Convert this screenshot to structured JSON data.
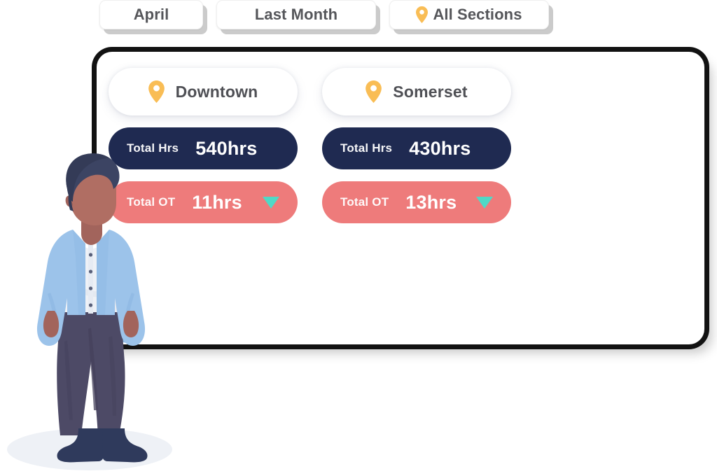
{
  "filters": [
    {
      "id": "month-select",
      "label": "April",
      "icon": null
    },
    {
      "id": "period-select",
      "label": "Last Month",
      "icon": null
    },
    {
      "id": "section-select",
      "label": "All Sections",
      "icon": "map-pin-icon"
    }
  ],
  "card": {
    "locations": [
      {
        "name": "Downtown",
        "icon": "map-pin-icon",
        "stats": [
          {
            "label": "Total Hrs",
            "value": "540hrs",
            "kind": "total-hours",
            "trend": null
          },
          {
            "label": "Total OT",
            "value": "11hrs",
            "kind": "total-overtime",
            "trend": "down-triangle-icon"
          }
        ]
      },
      {
        "name": "Somerset",
        "icon": "map-pin-icon",
        "stats": [
          {
            "label": "Total Hrs",
            "value": "430hrs",
            "kind": "total-hours",
            "trend": null
          },
          {
            "label": "Total OT",
            "value": "13hrs",
            "kind": "total-overtime",
            "trend": "down-triangle-icon"
          }
        ]
      }
    ]
  },
  "colors": {
    "navy": "#1f2a51",
    "coral": "#ee7b7b",
    "teal": "#4fd9c6",
    "pin_amber": "#f9bd55",
    "chip_text": "#55565a",
    "card_border": "#121212"
  },
  "illustration": {
    "name": "standing-person-illustration",
    "hair": "#3c4463",
    "skin": "#b06e63",
    "blazer": "#9cc3ea",
    "shirt": "#eef1f6",
    "trousers": "#4d4a66",
    "shoes": "#2f3a5c",
    "floor_shadow": "#eef1f6"
  }
}
